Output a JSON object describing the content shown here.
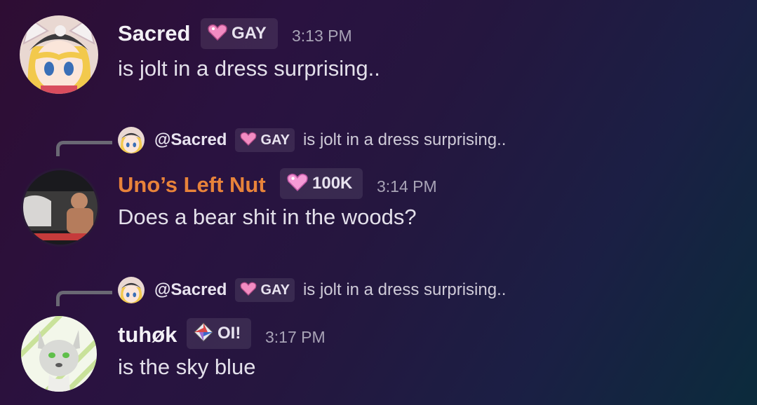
{
  "messages": [
    {
      "username": "Sacred",
      "username_color": "#f2f0f5",
      "tag_icon": "pink-heart-icon",
      "tag": "GAY",
      "timestamp": "3:13 PM",
      "content": "is jolt in a dress surprising.."
    },
    {
      "reply": {
        "mention": "@Sacred",
        "tag_icon": "pink-heart-icon",
        "tag": "GAY",
        "preview": "is jolt in a dress surprising.."
      },
      "username": "Uno’s Left Nut",
      "username_color": "#e8833a",
      "tag_icon": "heart-icon",
      "tag": "100K",
      "timestamp": "3:14 PM",
      "content": "Does a bear shit in the woods?"
    },
    {
      "reply": {
        "mention": "@Sacred",
        "tag_icon": "pink-heart-icon",
        "tag": "GAY",
        "preview": "is jolt in a dress surprising.."
      },
      "username": "tuhøk",
      "username_color": "#f2f0f5",
      "tag_icon": "diamond-compass-icon",
      "tag": "OI!",
      "timestamp": "3:17 PM",
      "content": "is the sky blue"
    }
  ]
}
